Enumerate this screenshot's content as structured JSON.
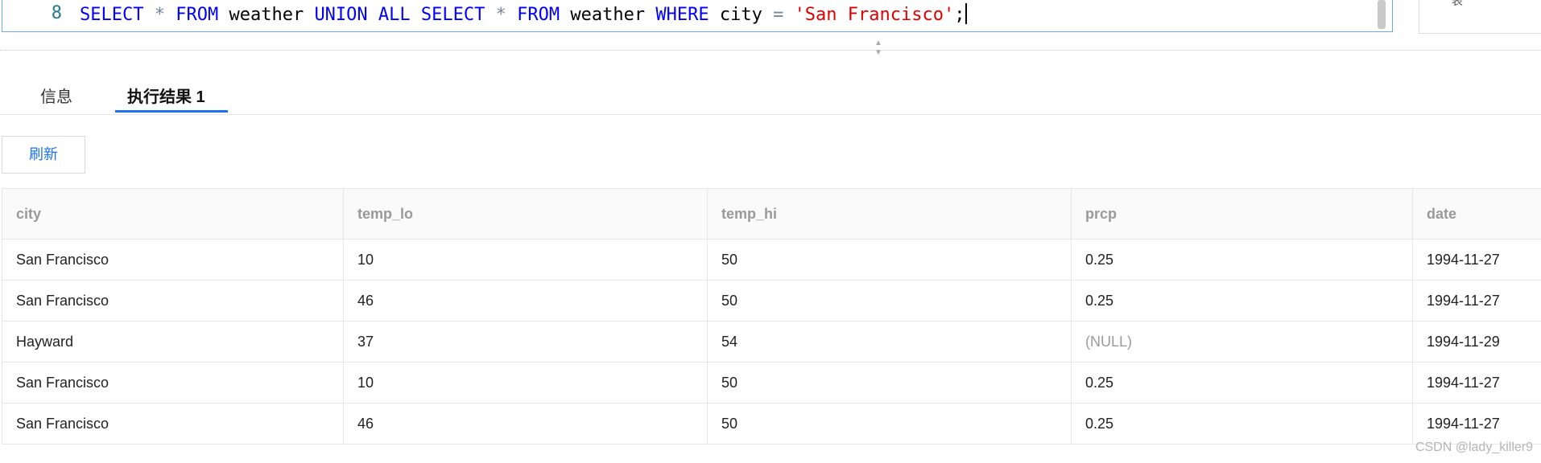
{
  "editor": {
    "line_number": "8",
    "sql": {
      "kw_select": "SELECT",
      "op_star": "*",
      "kw_from": "FROM",
      "table": "weather",
      "kw_union_all": "UNION ALL",
      "kw_where": "WHERE",
      "column": "city",
      "op_eq": "=",
      "literal": "'San Francisco'",
      "terminator": ";"
    }
  },
  "side_panel": {
    "label": "表"
  },
  "tabs": [
    {
      "label": "信息"
    },
    {
      "label": "执行结果 1",
      "active": true
    }
  ],
  "toolbar": {
    "refresh_label": "刷新"
  },
  "table": {
    "columns": [
      "city",
      "temp_lo",
      "temp_hi",
      "prcp",
      "date"
    ],
    "rows": [
      [
        "San Francisco",
        "10",
        "50",
        "0.25",
        "1994-11-27"
      ],
      [
        "San Francisco",
        "46",
        "50",
        "0.25",
        "1994-11-27"
      ],
      [
        "Hayward",
        "37",
        "54",
        "(NULL)",
        "1994-11-29"
      ],
      [
        "San Francisco",
        "10",
        "50",
        "0.25",
        "1994-11-27"
      ],
      [
        "San Francisco",
        "46",
        "50",
        "0.25",
        "1994-11-27"
      ]
    ]
  },
  "watermark": "CSDN @lady_killer9",
  "colors": {
    "accent": "#1a73e8",
    "keyword": "#0000ff",
    "string": "#e00000",
    "null_text": "#9a9a9a"
  }
}
